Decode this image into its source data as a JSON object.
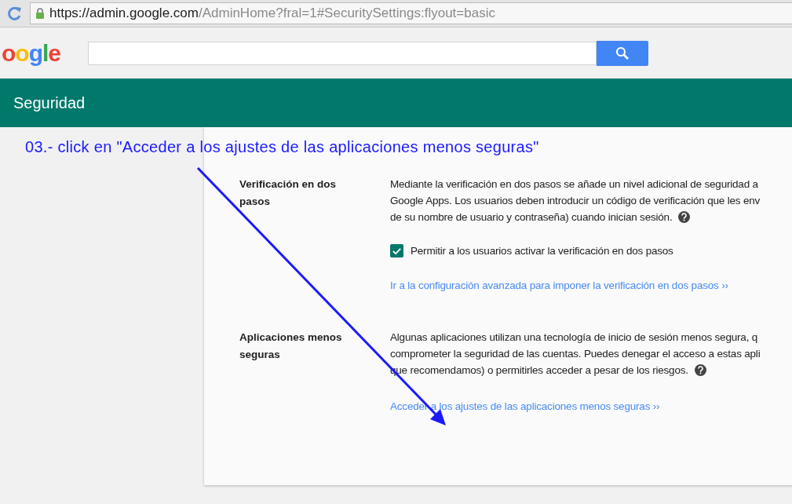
{
  "browser": {
    "url_host": "https://admin.google.com",
    "url_path": "/AdminHome?fral=1#SecuritySettings:flyout=basic"
  },
  "header": {
    "logo": "oogle"
  },
  "title_bar": {
    "title": "Seguridad"
  },
  "annotation": {
    "text": "03.- click en \"Acceder a los ajustes de las aplicaciones menos seguras\""
  },
  "sections": [
    {
      "label": "Verificación en dos pasos",
      "lines": [
        "Mediante la verificación en dos pasos se añade un nivel adicional de seguridad a",
        "Google Apps. Los usuarios deben introducir un código de verificación que les env",
        "de su nombre de usuario y contraseña) cuando inician sesión."
      ],
      "checkbox": {
        "label": "Permitir a los usuarios activar la verificación en dos pasos",
        "checked": true
      },
      "link": "Ir a la configuración avanzada para imponer la verificación en dos pasos ››"
    },
    {
      "label": "Aplicaciones menos seguras",
      "lines": [
        "Algunas aplicaciones utilizan una tecnología de inicio de sesión menos segura, q",
        "comprometer la seguridad de las cuentas. Puedes denegar el acceso a estas apli",
        "que recomendamos) o permitirles acceder a pesar de los riesgos."
      ],
      "link": "Acceder a los ajustes de las aplicaciones menos seguras ››"
    }
  ]
}
